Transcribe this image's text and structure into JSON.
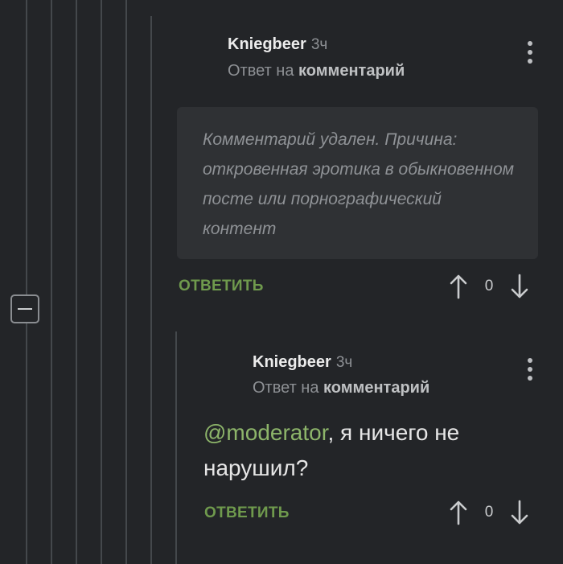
{
  "colors": {
    "background": "#232528",
    "thread_line": "#44484c",
    "deleted_box": "#2f3134",
    "accent_green": "#6f9a4d",
    "mention_green": "#8db56a"
  },
  "comments": [
    {
      "author": "Kniegbeer",
      "time": "3ч",
      "reply_prefix": "Ответ на",
      "reply_target": "комментарий",
      "deleted_text": "Комментарий удален. Причина: откровенная эротика в обыкновенном посте или порнографический контент",
      "reply_label": "ОТВЕТИТЬ",
      "score": "0",
      "upvote_icon": "arrow-up-icon",
      "downvote_icon": "arrow-down-icon",
      "menu_icon": "more-vertical-icon"
    },
    {
      "author": "Kniegbeer",
      "time": "3ч",
      "reply_prefix": "Ответ на",
      "reply_target": "комментарий",
      "mention": "@moderator",
      "text": ", я ничего не нарушил?",
      "reply_label": "ОТВЕТИТЬ",
      "score": "0",
      "upvote_icon": "arrow-up-icon",
      "downvote_icon": "arrow-down-icon",
      "menu_icon": "more-vertical-icon"
    }
  ],
  "collapse_icon": "minus-icon"
}
